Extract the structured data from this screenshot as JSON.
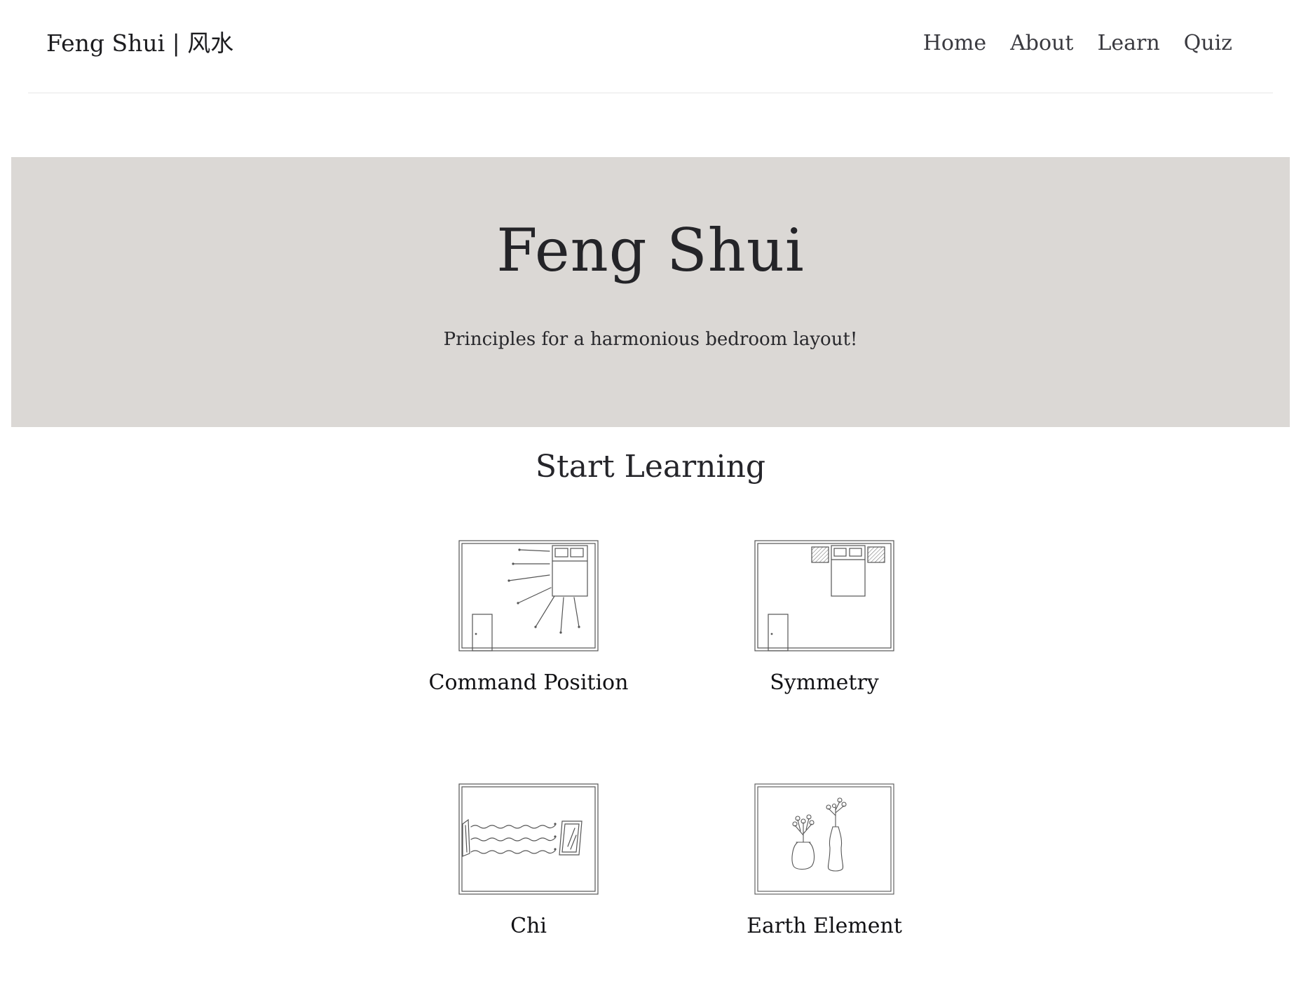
{
  "navbar": {
    "brand": "Feng Shui | 风水",
    "links": [
      "Home",
      "About",
      "Learn",
      "Quiz"
    ]
  },
  "hero": {
    "title": "Feng Shui",
    "subtitle": "Principles for a harmonious bedroom layout!"
  },
  "learning": {
    "title": "Start Learning",
    "cards": [
      {
        "label": "Command Position",
        "icon": "command-position-sketch"
      },
      {
        "label": "Symmetry",
        "icon": "symmetry-sketch"
      },
      {
        "label": "Chi",
        "icon": "chi-sketch"
      },
      {
        "label": "Earth Element",
        "icon": "earth-element-sketch"
      }
    ]
  },
  "colors": {
    "hero_background": "#dbd8d5",
    "text": "#222225",
    "sketch_line": "#555555"
  }
}
